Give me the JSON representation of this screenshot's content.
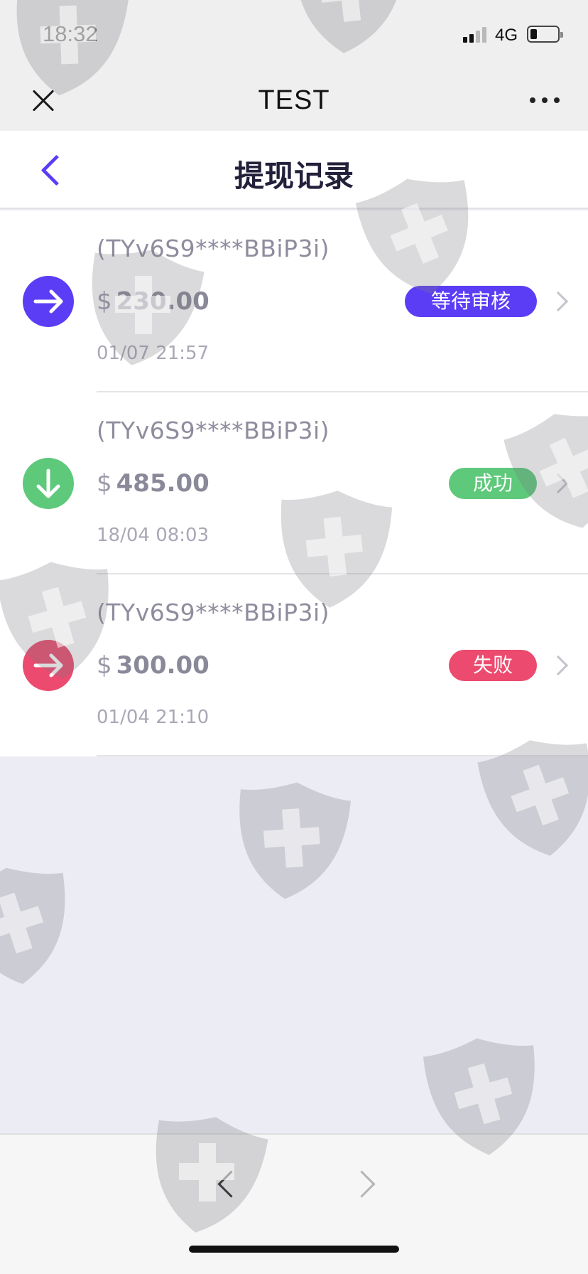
{
  "status_bar": {
    "time": "18:32",
    "network": "4G"
  },
  "app_bar": {
    "title": "TEST",
    "close_icon": "close-icon",
    "more_icon": "more-dots-icon"
  },
  "page": {
    "title": "提现记录",
    "back_icon": "chevron-left-icon"
  },
  "records": [
    {
      "address": "(TYv6S9****BBiP3i)",
      "currency": "$",
      "amount": "230.00",
      "time": "01/07 21:57",
      "status": "等待审核",
      "icon": "arrow-right-icon",
      "icon_color": "#5b3df5",
      "status_color": "#5b3df5"
    },
    {
      "address": "(TYv6S9****BBiP3i)",
      "currency": "$",
      "amount": "485.00",
      "time": "18/04 08:03",
      "status": "成功",
      "icon": "arrow-down-icon",
      "icon_color": "#5ec97a",
      "status_color": "#5ec97a"
    },
    {
      "address": "(TYv6S9****BBiP3i)",
      "currency": "$",
      "amount": "300.00",
      "time": "01/04 21:10",
      "status": "失败",
      "icon": "arrow-right-icon",
      "icon_color": "#ec4a6e",
      "status_color": "#ec4a6e"
    }
  ],
  "bottom_bar": {
    "back_icon": "browser-back-icon",
    "forward_icon": "browser-forward-icon"
  },
  "colors": {
    "accent": "#5b3df5",
    "success": "#5ec97a",
    "failure": "#ec4a6e",
    "background": "#ececf4"
  }
}
